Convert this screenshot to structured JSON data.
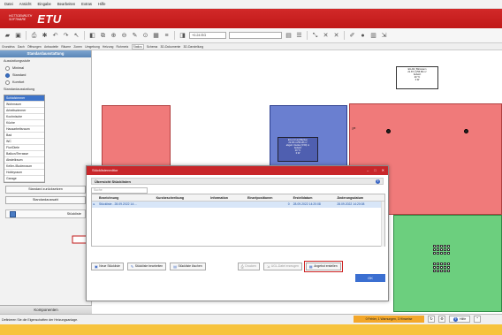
{
  "menu": [
    "Datei",
    "Ansicht",
    "Eingabe",
    "Bearbeiten",
    "Extras",
    "Hilfe"
  ],
  "brand": {
    "line1": "HOTTGENROTH",
    "line2": "SOFTWARE",
    "logo": "ETU",
    "color": "#c8262a"
  },
  "toolbar": {
    "value_input": "+0.24 EG"
  },
  "ribbon": {
    "items": [
      "Grundriss",
      "Dach",
      "Öffnungen",
      "Anbauteile",
      "Räume",
      "Zonen",
      "Umgebung",
      "Heizung",
      "Rohrnetz",
      "Statics",
      "Schema",
      "3D-Dokumente",
      "3D-Darstellung"
    ],
    "active_index": 9
  },
  "left": {
    "title": "Standardausstattung",
    "level_label": "Ausstattungsstufe",
    "levels": [
      {
        "label": "Minimal",
        "selected": false
      },
      {
        "label": "Standard",
        "selected": true
      },
      {
        "label": "Komfort",
        "selected": false
      }
    ],
    "room_label": "Standardausstattung",
    "rooms": [
      "Schlafzimmer",
      "Wohnraum",
      "Arbeitszimmer",
      "Kochnische",
      "Küche",
      "Hausarbeitsraum",
      "Bad",
      "WC",
      "Flur/Diele",
      "Balkon/Terrasse",
      "Abstellraum",
      "Keller-/Bodenraum",
      "Hobbyraum",
      "Garage"
    ],
    "selected_room_index": 0,
    "btn_reset": "Standard zurücksetzen",
    "btn_matrix": "Standardauswahl",
    "stueckliste": "Stückliste",
    "komponenten": "Komponenten"
  },
  "canvas": {
    "info_top": [
      "EG-R2_Büroraum",
      "21.87 m²/55.86 m³",
      "beheizt",
      "20 °C",
      "0 W"
    ],
    "info_mid": [
      "EG-H1 Heizflächen",
      "22.36 m²/56.28 m³",
      "abgeh. Decke (3.50) m",
      "beheizt",
      "20 °C",
      "0 W"
    ],
    "colors": {
      "pink": "#f07a7a",
      "blue": "#6a7fd0",
      "green": "#6ccf7e"
    }
  },
  "dialog": {
    "title": "Stücklisteneditor",
    "section": "Übersicht Stücklisten",
    "search_placeholder": "Suche",
    "columns": [
      "Bezeichnung",
      "Kurzbeschreibung",
      "Information",
      "Einzelpositionen",
      "Erstelldatum",
      "Änderungsdatum"
    ],
    "row": {
      "bezeichnung": "Stückliste - 28.09.2022 14:...",
      "kurz": "",
      "info": "",
      "einzel": "0",
      "erstell": "28.09.2022 14:20:08",
      "aender": "28.09.2022 14:20:08"
    },
    "buttons": {
      "neu": "Neue Stückliste",
      "bearbeiten": "Stückliste bearbeiten",
      "loeschen": "Stückliste löschen",
      "drucken": "Drucken",
      "ugs": "UGL-Datei erzeugen",
      "angebot": "Angebot erstellen",
      "ok": "OK"
    }
  },
  "status": {
    "text": "Definieren Sie die Eigenschaften der Heizungsanlage.",
    "warnings": "0 Fehler, 1 Warnungen, 3 Hinweise",
    "hilfe": "Hilfe"
  }
}
